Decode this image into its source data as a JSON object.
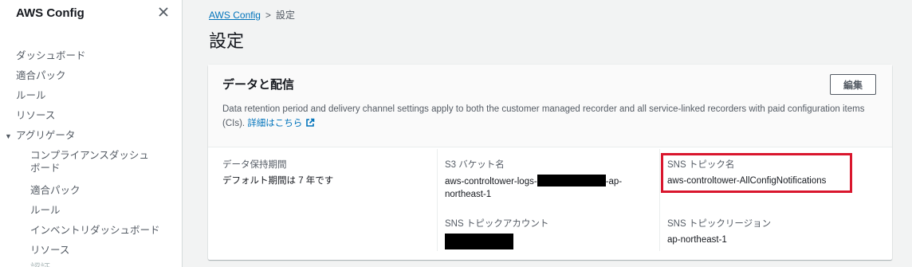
{
  "sidebar": {
    "title": "AWS Config",
    "items": [
      {
        "label": "ダッシュボード"
      },
      {
        "label": "適合パック"
      },
      {
        "label": "ルール"
      },
      {
        "label": "リソース"
      }
    ],
    "group": {
      "label": "アグリゲータ",
      "items": [
        {
          "label": "コンプライアンスダッシュボード"
        },
        {
          "label": "適合パック"
        },
        {
          "label": "ルール"
        },
        {
          "label": "インベントリダッシュボード"
        },
        {
          "label": "リソース"
        },
        {
          "label": "認証"
        }
      ]
    }
  },
  "breadcrumb": {
    "root": "AWS Config",
    "separator": ">",
    "current": "設定"
  },
  "page": {
    "title": "設定"
  },
  "panel": {
    "title": "データと配信",
    "edit_label": "編集",
    "description": "Data retention period and delivery channel settings apply to both the customer managed recorder and all service-linked recorders with paid configuration items (CIs).",
    "link_label": "詳細はこちら",
    "fields": {
      "retention_label": "データ保持期間",
      "retention_value": "デフォルト期間は 7 年です",
      "s3_label": "S3 バケット名",
      "s3_value_prefix": "aws-controltower-logs-",
      "s3_value_suffix": "-ap-northeast-1",
      "sns_topic_label": "SNS トピック名",
      "sns_topic_value": "aws-controltower-AllConfigNotifications",
      "sns_account_label": "SNS トピックアカウント",
      "sns_region_label": "SNS トピックリージョン",
      "sns_region_value": "ap-northeast-1"
    }
  },
  "colors": {
    "link": "#0073bb",
    "highlight": "#d9162d",
    "redaction": "#000000"
  }
}
